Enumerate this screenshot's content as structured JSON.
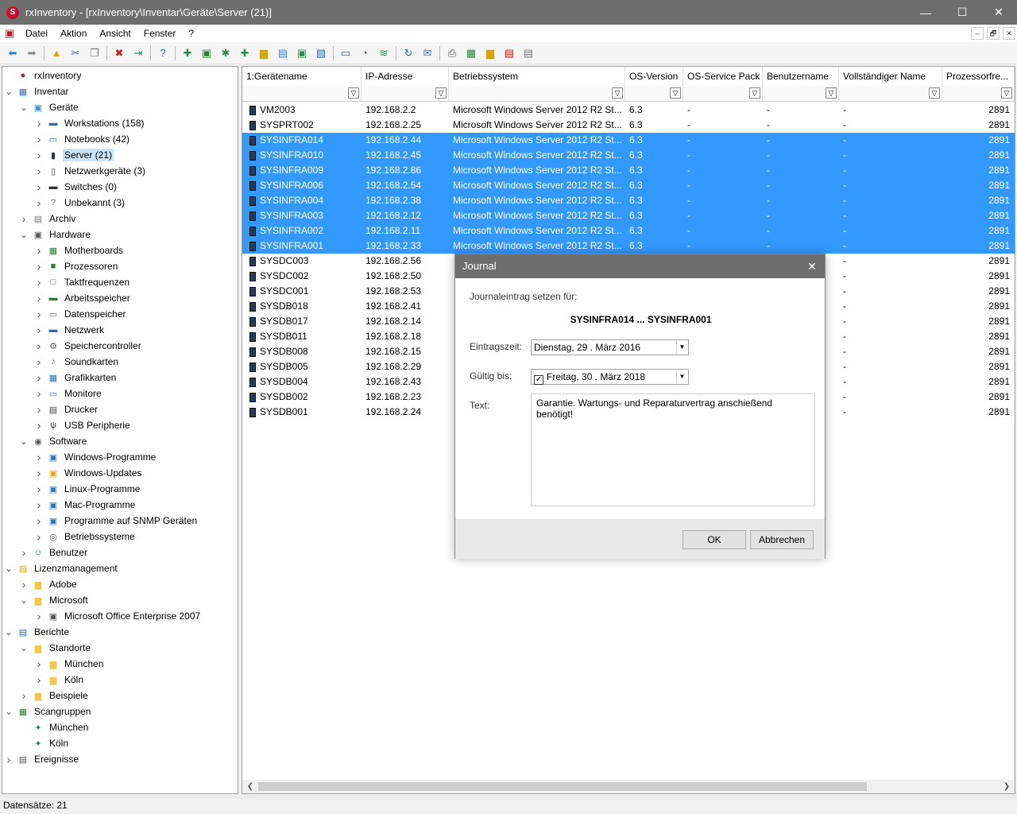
{
  "window": {
    "title": "rxInventory - [rxInventory\\Inventar\\Geräte\\Server (21)]",
    "minimize": "—",
    "maximize": "☐",
    "close": "✕"
  },
  "menu": [
    "Datei",
    "Aktion",
    "Ansicht",
    "Fenster",
    "?"
  ],
  "mdi_controls": [
    "–",
    "🗗",
    "✕"
  ],
  "toolbar_icons": [
    "back-arrow-icon",
    "forward-arrow-icon",
    "folder-up-icon",
    "cut-icon",
    "copy-icon",
    "delete-icon",
    "export-icon",
    "help-icon",
    "scan-icon",
    "save-icon",
    "network-scan-icon",
    "add-icon",
    "folder-add-icon",
    "properties-icon",
    "add-device-icon",
    "remote-icon",
    "monitor-icon",
    "clock-icon",
    "wifi-icon",
    "refresh-icon",
    "mail-icon",
    "print-icon",
    "excel-icon",
    "folder-export-icon",
    "pdf-icon",
    "notes-icon"
  ],
  "tree": [
    {
      "label": "rxInventory",
      "level": 0,
      "exp": "",
      "icon": "app-icon",
      "glyph": "●",
      "color": "#c8102e"
    },
    {
      "label": "Inventar",
      "level": 0,
      "exp": "open",
      "icon": "inventory-icon",
      "glyph": "▦",
      "color": "#3a6ea5"
    },
    {
      "label": "Geräte",
      "level": 1,
      "exp": "open",
      "icon": "devices-icon",
      "glyph": "▣",
      "color": "#3a8fd0"
    },
    {
      "label": "Workstations (158)",
      "level": 2,
      "exp": "closed",
      "icon": "workstation-icon",
      "glyph": "▬",
      "color": "#2a6fb5"
    },
    {
      "label": "Notebooks (42)",
      "level": 2,
      "exp": "closed",
      "icon": "notebook-icon",
      "glyph": "▭",
      "color": "#2a6fb5"
    },
    {
      "label": "Server (21)",
      "level": 2,
      "exp": "closed",
      "icon": "server-icon",
      "glyph": "▮",
      "color": "#2a3a55",
      "selected": true
    },
    {
      "label": "Netzwerkgeräte (3)",
      "level": 2,
      "exp": "closed",
      "icon": "network-device-icon",
      "glyph": "▯",
      "color": "#444"
    },
    {
      "label": "Switches (0)",
      "level": 2,
      "exp": "closed",
      "icon": "switch-icon",
      "glyph": "▬",
      "color": "#333"
    },
    {
      "label": "Unbekannt (3)",
      "level": 2,
      "exp": "closed",
      "icon": "unknown-device-icon",
      "glyph": "?",
      "color": "#666"
    },
    {
      "label": "Archiv",
      "level": 1,
      "exp": "closed",
      "icon": "archive-icon",
      "glyph": "▤",
      "color": "#777"
    },
    {
      "label": "Hardware",
      "level": 1,
      "exp": "open",
      "icon": "hardware-icon",
      "glyph": "▣",
      "color": "#555"
    },
    {
      "label": "Motherboards",
      "level": 2,
      "exp": "closed",
      "icon": "motherboard-icon",
      "glyph": "▦",
      "color": "#2e7d32"
    },
    {
      "label": "Prozessoren",
      "level": 2,
      "exp": "closed",
      "icon": "processor-icon",
      "glyph": "■",
      "color": "#2e7d32"
    },
    {
      "label": "Taktfrequenzen",
      "level": 2,
      "exp": "closed",
      "icon": "clock-frequency-icon",
      "glyph": "□",
      "color": "#2e7d32"
    },
    {
      "label": "Arbeitsspeicher",
      "level": 2,
      "exp": "closed",
      "icon": "memory-icon",
      "glyph": "▬",
      "color": "#2e7d32"
    },
    {
      "label": "Datenspeicher",
      "level": 2,
      "exp": "closed",
      "icon": "disk-icon",
      "glyph": "▭",
      "color": "#666"
    },
    {
      "label": "Netzwerk",
      "level": 2,
      "exp": "closed",
      "icon": "network-icon",
      "glyph": "▬",
      "color": "#2a6fb5"
    },
    {
      "label": "Speichercontroller",
      "level": 2,
      "exp": "closed",
      "icon": "storage-controller-icon",
      "glyph": "⚙",
      "color": "#555"
    },
    {
      "label": "Soundkarten",
      "level": 2,
      "exp": "closed",
      "icon": "sound-icon",
      "glyph": "♪",
      "color": "#555"
    },
    {
      "label": "Grafikkarten",
      "level": 2,
      "exp": "closed",
      "icon": "graphics-card-icon",
      "glyph": "▦",
      "color": "#2a6fb5"
    },
    {
      "label": "Monitore",
      "level": 2,
      "exp": "closed",
      "icon": "monitor-icon",
      "glyph": "▭",
      "color": "#2a6fb5"
    },
    {
      "label": "Drucker",
      "level": 2,
      "exp": "closed",
      "icon": "printer-icon",
      "glyph": "▤",
      "color": "#444"
    },
    {
      "label": "USB Peripherie",
      "level": 2,
      "exp": "closed",
      "icon": "usb-icon",
      "glyph": "ψ",
      "color": "#333"
    },
    {
      "label": "Software",
      "level": 1,
      "exp": "open",
      "icon": "software-icon",
      "glyph": "◉",
      "color": "#555"
    },
    {
      "label": "Windows-Programme",
      "level": 2,
      "exp": "closed",
      "icon": "windows-programs-icon",
      "glyph": "▣",
      "color": "#2a6fb5"
    },
    {
      "label": "Windows-Updates",
      "level": 2,
      "exp": "closed",
      "icon": "windows-updates-icon",
      "glyph": "▣",
      "color": "#e6a020"
    },
    {
      "label": "Linux-Programme",
      "level": 2,
      "exp": "closed",
      "icon": "linux-programs-icon",
      "glyph": "▣",
      "color": "#2a6fb5"
    },
    {
      "label": "Mac-Programme",
      "level": 2,
      "exp": "closed",
      "icon": "mac-programs-icon",
      "glyph": "▣",
      "color": "#2a6fb5"
    },
    {
      "label": "Programme auf SNMP Geräten",
      "level": 2,
      "exp": "closed",
      "icon": "snmp-programs-icon",
      "glyph": "▣",
      "color": "#2a6fb5"
    },
    {
      "label": "Betriebssysteme",
      "level": 2,
      "exp": "closed",
      "icon": "operating-system-icon",
      "glyph": "◎",
      "color": "#555"
    },
    {
      "label": "Benutzer",
      "level": 1,
      "exp": "closed",
      "icon": "users-icon",
      "glyph": "☺",
      "color": "#2a6fb5"
    },
    {
      "label": "Lizenzmanagement",
      "level": 0,
      "exp": "open",
      "icon": "license-icon",
      "glyph": "▤",
      "color": "#d8a400"
    },
    {
      "label": "Adobe",
      "level": 1,
      "exp": "closed",
      "icon": "folder-icon",
      "glyph": "▆",
      "color": "#f0c94a"
    },
    {
      "label": "Microsoft",
      "level": 1,
      "exp": "open",
      "icon": "folder-icon",
      "glyph": "▆",
      "color": "#f0c94a"
    },
    {
      "label": "Microsoft Office Enterprise 2007",
      "level": 2,
      "exp": "closed",
      "icon": "license-package-icon",
      "glyph": "▣",
      "color": "#555"
    },
    {
      "label": "Berichte",
      "level": 0,
      "exp": "open",
      "icon": "reports-icon",
      "glyph": "▤",
      "color": "#2a6fb5"
    },
    {
      "label": "Standorte",
      "level": 1,
      "exp": "open",
      "icon": "folder-icon",
      "glyph": "▆",
      "color": "#f0c94a"
    },
    {
      "label": "München",
      "level": 2,
      "exp": "closed",
      "icon": "report-folder-icon",
      "glyph": "▆",
      "color": "#f0c94a"
    },
    {
      "label": "Köln",
      "level": 2,
      "exp": "closed",
      "icon": "report-folder-icon",
      "glyph": "▆",
      "color": "#f0c94a"
    },
    {
      "label": "Beispiele",
      "level": 1,
      "exp": "closed",
      "icon": "folder-icon",
      "glyph": "▆",
      "color": "#f0c94a"
    },
    {
      "label": "Scangruppen",
      "level": 0,
      "exp": "open",
      "icon": "scan-groups-icon",
      "glyph": "▦",
      "color": "#2e7d32"
    },
    {
      "label": "München",
      "level": 1,
      "exp": "",
      "icon": "scan-group-icon",
      "glyph": "✦",
      "color": "#2e8b57"
    },
    {
      "label": "Köln",
      "level": 1,
      "exp": "",
      "icon": "scan-group-icon",
      "glyph": "✦",
      "color": "#2e8b57"
    },
    {
      "label": "Ereignisse",
      "level": 0,
      "exp": "closed",
      "icon": "events-icon",
      "glyph": "▤",
      "color": "#555"
    }
  ],
  "grid": {
    "columns": [
      "1:Gerätename",
      "IP-Adresse",
      "Betriebssystem",
      "OS-Version",
      "OS-Service Pack",
      "Benutzername",
      "Vollständiger Name",
      "Prozessorfre..."
    ],
    "rows": [
      {
        "name": "VM2003",
        "ip": "192.168.2.2",
        "os": "Microsoft Windows Server 2012 R2 St...",
        "ver": "6.3",
        "sp": "-",
        "user": "-",
        "full": "-",
        "cpu": "2891",
        "selected": false
      },
      {
        "name": "SYSPRT002",
        "ip": "192.168.2.25",
        "os": "Microsoft Windows Server 2012 R2 St...",
        "ver": "6.3",
        "sp": "-",
        "user": "-",
        "full": "-",
        "cpu": "2891",
        "selected": false
      },
      {
        "name": "SYSINFRA014",
        "ip": "192.168.2.44",
        "os": "Microsoft Windows Server 2012 R2 St...",
        "ver": "6.3",
        "sp": "-",
        "user": "-",
        "full": "-",
        "cpu": "2891",
        "selected": true
      },
      {
        "name": "SYSINFRA010",
        "ip": "192.168.2.45",
        "os": "Microsoft Windows Server 2012 R2 St...",
        "ver": "6.3",
        "sp": "-",
        "user": "-",
        "full": "-",
        "cpu": "2891",
        "selected": true
      },
      {
        "name": "SYSINFRA009",
        "ip": "192.168.2.86",
        "os": "Microsoft Windows Server 2012 R2 St...",
        "ver": "6.3",
        "sp": "-",
        "user": "-",
        "full": "-",
        "cpu": "2891",
        "selected": true
      },
      {
        "name": "SYSINFRA006",
        "ip": "192.168.2.54",
        "os": "Microsoft Windows Server 2012 R2 St...",
        "ver": "6.3",
        "sp": "-",
        "user": "-",
        "full": "-",
        "cpu": "2891",
        "selected": true
      },
      {
        "name": "SYSINFRA004",
        "ip": "192.168.2.38",
        "os": "Microsoft Windows Server 2012 R2 St...",
        "ver": "6.3",
        "sp": "-",
        "user": "-",
        "full": "-",
        "cpu": "2891",
        "selected": true
      },
      {
        "name": "SYSINFRA003",
        "ip": "192.168.2.12",
        "os": "Microsoft Windows Server 2012 R2 St...",
        "ver": "6.3",
        "sp": "-",
        "user": "-",
        "full": "-",
        "cpu": "2891",
        "selected": true
      },
      {
        "name": "SYSINFRA002",
        "ip": "192.168.2.11",
        "os": "Microsoft Windows Server 2012 R2 St...",
        "ver": "6.3",
        "sp": "-",
        "user": "-",
        "full": "-",
        "cpu": "2891",
        "selected": true
      },
      {
        "name": "SYSINFRA001",
        "ip": "192.168.2.33",
        "os": "Microsoft Windows Server 2012 R2 St...",
        "ver": "6.3",
        "sp": "-",
        "user": "-",
        "full": "-",
        "cpu": "2891",
        "selected": true
      },
      {
        "name": "SYSDC003",
        "ip": "192.168.2.56",
        "os": "",
        "ver": "",
        "sp": "",
        "user": "",
        "full": "-",
        "cpu": "2891",
        "selected": false
      },
      {
        "name": "SYSDC002",
        "ip": "192.168.2.50",
        "os": "",
        "ver": "",
        "sp": "",
        "user": "",
        "full": "-",
        "cpu": "2891",
        "selected": false
      },
      {
        "name": "SYSDC001",
        "ip": "192.168.2.53",
        "os": "",
        "ver": "",
        "sp": "",
        "user": "",
        "full": "-",
        "cpu": "2891",
        "selected": false
      },
      {
        "name": "SYSDB018",
        "ip": "192.168.2.41",
        "os": "",
        "ver": "",
        "sp": "",
        "user": "",
        "full": "-",
        "cpu": "2891",
        "selected": false
      },
      {
        "name": "SYSDB017",
        "ip": "192.168.2.14",
        "os": "",
        "ver": "",
        "sp": "",
        "user": "",
        "full": "-",
        "cpu": "2891",
        "selected": false
      },
      {
        "name": "SYSDB011",
        "ip": "192.168.2.18",
        "os": "",
        "ver": "",
        "sp": "",
        "user": "",
        "full": "-",
        "cpu": "2891",
        "selected": false
      },
      {
        "name": "SYSDB008",
        "ip": "192.168.2.15",
        "os": "",
        "ver": "",
        "sp": "",
        "user": "",
        "full": "-",
        "cpu": "2891",
        "selected": false
      },
      {
        "name": "SYSDB005",
        "ip": "192.168.2.29",
        "os": "",
        "ver": "",
        "sp": "",
        "user": "",
        "full": "-",
        "cpu": "2891",
        "selected": false
      },
      {
        "name": "SYSDB004",
        "ip": "192.168.2.43",
        "os": "",
        "ver": "",
        "sp": "",
        "user": "",
        "full": "-",
        "cpu": "2891",
        "selected": false
      },
      {
        "name": "SYSDB002",
        "ip": "192.168.2.23",
        "os": "",
        "ver": "",
        "sp": "",
        "user": "",
        "full": "-",
        "cpu": "2891",
        "selected": false
      },
      {
        "name": "SYSDB001",
        "ip": "192.168.2.24",
        "os": "",
        "ver": "",
        "sp": "",
        "user": "",
        "full": "-",
        "cpu": "2891",
        "selected": false
      }
    ]
  },
  "status": {
    "text": "Datensätze: 21"
  },
  "dialog": {
    "title": "Journal",
    "close": "✕",
    "intro": "Journaleintrag setzen für:",
    "target": "SYSINFRA014 ... SYSINFRA001",
    "entry_label": "Eintragszeit:",
    "entry_value": "Dienstag, 29 . März 2016",
    "valid_label": "Gültig bis:",
    "valid_checked": true,
    "valid_value": "Freitag, 30 . März 2018",
    "text_label": "Text:",
    "text_value": "Garantie. Wartungs- und Reparaturvertrag anschießend benötigt!",
    "ok": "OK",
    "cancel": "Abbrechen"
  }
}
